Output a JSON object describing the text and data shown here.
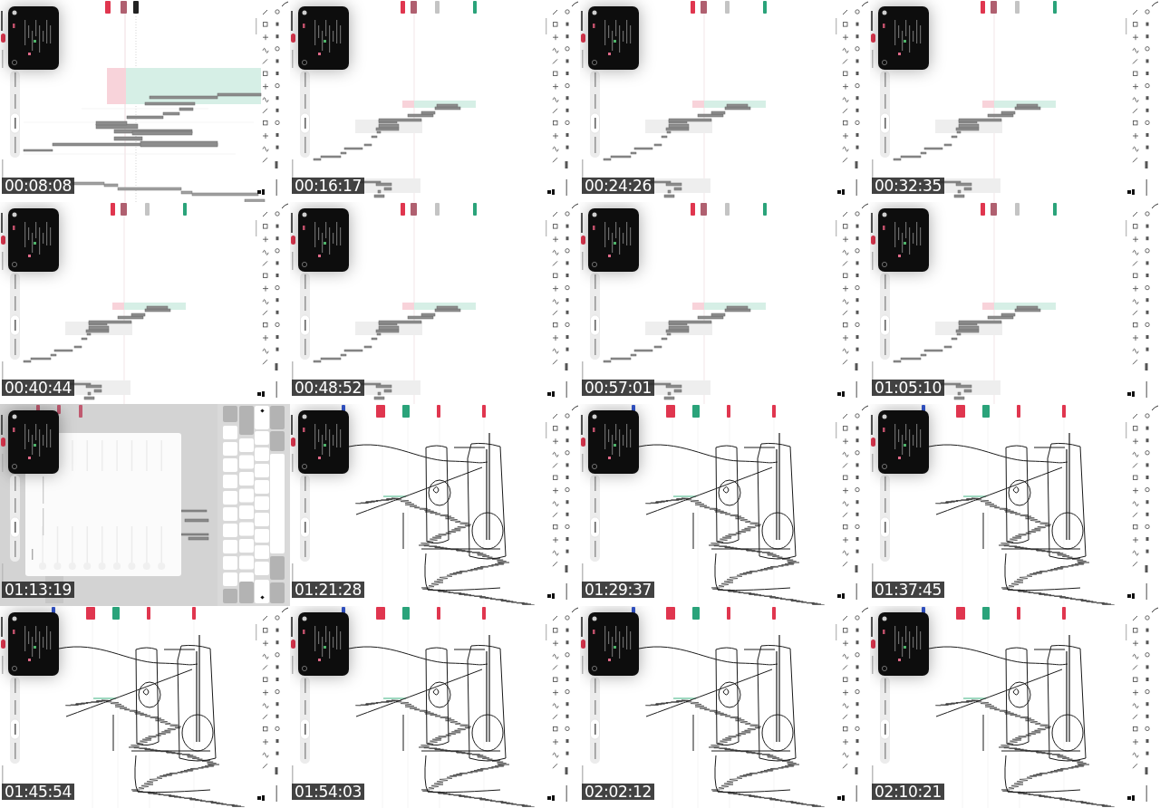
{
  "frames": [
    {
      "timestamp": "00:08:08",
      "kind": "closeup"
    },
    {
      "timestamp": "00:16:17",
      "kind": "zones"
    },
    {
      "timestamp": "00:24:26",
      "kind": "zones"
    },
    {
      "timestamp": "00:32:35",
      "kind": "zones"
    },
    {
      "timestamp": "00:40:44",
      "kind": "zones"
    },
    {
      "timestamp": "00:48:52",
      "kind": "zones"
    },
    {
      "timestamp": "00:57:01",
      "kind": "zones"
    },
    {
      "timestamp": "01:05:10",
      "kind": "zones"
    },
    {
      "timestamp": "01:13:19",
      "kind": "keyboard"
    },
    {
      "timestamp": "01:21:28",
      "kind": "scribble"
    },
    {
      "timestamp": "01:29:37",
      "kind": "scribble"
    },
    {
      "timestamp": "01:37:45",
      "kind": "scribble"
    },
    {
      "timestamp": "01:45:54",
      "kind": "scribble"
    },
    {
      "timestamp": "01:54:03",
      "kind": "scribble"
    },
    {
      "timestamp": "02:02:12",
      "kind": "scribble"
    },
    {
      "timestamp": "02:10:21",
      "kind": "scribble"
    }
  ]
}
